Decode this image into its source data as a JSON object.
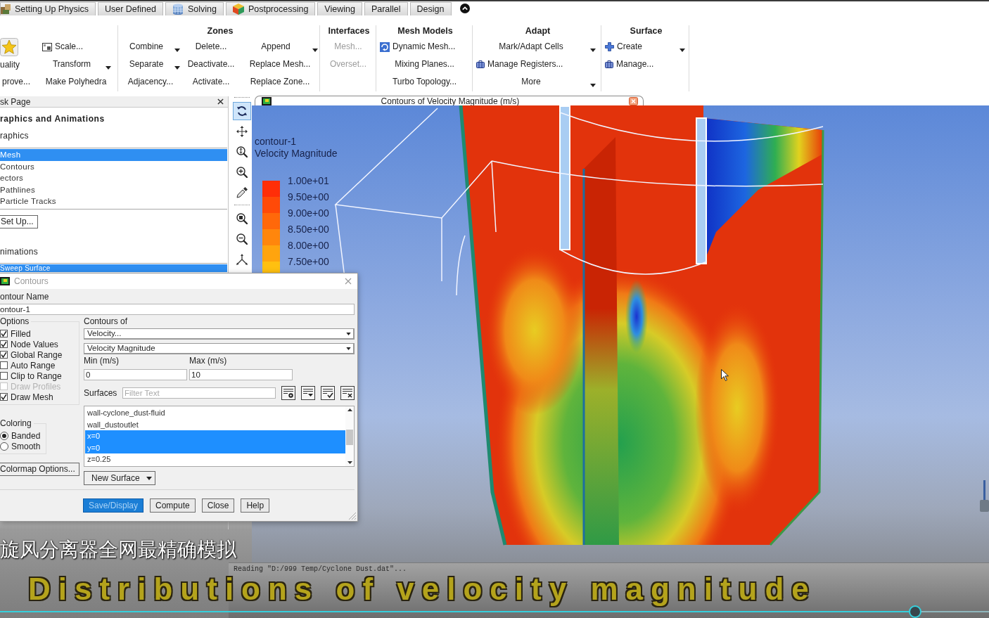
{
  "tabs": [
    {
      "label": "Setting Up Physics",
      "selected": false
    },
    {
      "label": "User Defined",
      "selected": false
    },
    {
      "label": "Solving",
      "selected": false
    },
    {
      "label": "Postprocessing",
      "selected": false
    },
    {
      "label": "Viewing",
      "selected": false
    },
    {
      "label": "Parallel",
      "selected": false
    },
    {
      "label": "Design",
      "selected": false
    }
  ],
  "ribbon": {
    "groups": [
      {
        "large_button": "uality",
        "columns": [
          [
            {
              "label": "prove..."
            }
          ],
          [
            {
              "label": "Scale...",
              "dropdown": false
            },
            {
              "label": "Transform",
              "dropdown": true
            },
            {
              "label": "Make Polyhedra",
              "dropdown": false
            }
          ]
        ]
      },
      {
        "title": "Zones",
        "columns": [
          [
            {
              "label": "Combine",
              "dropdown": true
            },
            {
              "label": "Separate",
              "dropdown": true
            },
            {
              "label": "Adjacency...",
              "dropdown": false
            }
          ],
          [
            {
              "label": "Delete..."
            },
            {
              "label": "Deactivate..."
            },
            {
              "label": "Activate..."
            }
          ],
          [
            {
              "label": "Append",
              "dropdown": true
            },
            {
              "label": "Replace Mesh...",
              "dropdown": false
            },
            {
              "label": "Replace Zone...",
              "dropdown": false
            }
          ]
        ]
      },
      {
        "title": "Interfaces",
        "columns": [
          [
            {
              "label": "Mesh...",
              "disabled": true
            },
            {
              "label": "Overset...",
              "disabled": true
            }
          ]
        ]
      },
      {
        "title": "Mesh Models",
        "columns": [
          [
            {
              "label": "Dynamic Mesh..."
            },
            {
              "label": "Mixing Planes..."
            },
            {
              "label": "Turbo Topology..."
            }
          ]
        ]
      },
      {
        "title": "Adapt",
        "columns": [
          [
            {
              "label": "Mark/Adapt Cells",
              "dropdown": true
            },
            {
              "label": "Manage Registers...",
              "dropdown": false
            },
            {
              "label": "More",
              "dropdown": true
            }
          ]
        ]
      },
      {
        "title": "Surface",
        "columns": [
          [
            {
              "label": "Create",
              "dropdown": true
            },
            {
              "label": "Manage...",
              "dropdown": false
            }
          ]
        ]
      }
    ]
  },
  "task_page": {
    "title": "sk Page",
    "heading": "raphics and Animations",
    "sections": [
      {
        "label": "raphics",
        "items": [
          {
            "label": "Mesh",
            "selected": true
          },
          {
            "label": "Contours",
            "selected": false
          },
          {
            "label": "ectors",
            "selected": false
          },
          {
            "label": "Pathlines",
            "selected": false
          },
          {
            "label": "Particle Tracks",
            "selected": false
          }
        ],
        "button": "Set Up..."
      },
      {
        "label": "nimations",
        "items": [
          {
            "label": "Sweep Surface",
            "selected": true
          }
        ]
      }
    ]
  },
  "graphics_toolbar": {
    "groups": [
      [
        {
          "selected": true
        },
        {
          "selected": false
        },
        {
          "selected": false
        },
        {
          "selected": false
        },
        {
          "selected": false
        }
      ],
      [
        {
          "selected": false
        },
        {
          "selected": false
        },
        {
          "selected": false
        }
      ]
    ]
  },
  "graphics_window": {
    "title": "Contours of Velocity Magnitude (m/s)",
    "legend": {
      "name": "contour-1",
      "quantity": "Velocity Magnitude",
      "levels": [
        {
          "label": "1.00e+01",
          "color": "#ff2e08"
        },
        {
          "label": "9.50e+00",
          "color": "#ff4a08"
        },
        {
          "label": "9.00e+00",
          "color": "#ff680a"
        },
        {
          "label": "8.50e+00",
          "color": "#ff860c"
        },
        {
          "label": "8.00e+00",
          "color": "#ffa40e"
        },
        {
          "label": "7.50e+00",
          "color": "#ffc010"
        }
      ]
    }
  },
  "console": {
    "lines": [
      "Reading \"D:/999 Temp/Cyclone Dust.dat\"..."
    ]
  },
  "contours_dialog": {
    "title": "Contours",
    "name_field": {
      "label": "ontour Name",
      "value": "ontour-1"
    },
    "options": {
      "label": "Options",
      "items": [
        {
          "label": "Filled",
          "checked": true,
          "disabled": false
        },
        {
          "label": "Node Values",
          "checked": true,
          "disabled": false
        },
        {
          "label": "Global Range",
          "checked": true,
          "disabled": false
        },
        {
          "label": "Auto Range",
          "checked": false,
          "disabled": false
        },
        {
          "label": "Clip to Range",
          "checked": false,
          "disabled": false
        },
        {
          "label": "Draw Profiles",
          "checked": false,
          "disabled": true
        },
        {
          "label": "Draw Mesh",
          "checked": true,
          "disabled": false
        }
      ]
    },
    "coloring": {
      "label": "Coloring",
      "options": [
        {
          "label": "Banded",
          "selected": true
        },
        {
          "label": "Smooth",
          "selected": false
        }
      ]
    },
    "colormap_button": "Colormap Options...",
    "contours_of": {
      "label": "Contours of",
      "category": "Velocity...",
      "quantity": "Velocity Magnitude"
    },
    "range": [
      {
        "label": "Min (m/s)",
        "value": "0"
      },
      {
        "label": "Max (m/s)",
        "value": "10"
      }
    ],
    "surfaces": {
      "label": "Surfaces",
      "placeholder": "Filter Text",
      "items": [
        {
          "label": "wall-cyclone_dust-fluid",
          "selected": false
        },
        {
          "label": "wall_dustoutlet",
          "selected": false
        },
        {
          "label": "x=0",
          "selected": true
        },
        {
          "label": "y=0",
          "selected": true
        },
        {
          "label": "z=0.25",
          "selected": false
        }
      ]
    },
    "new_surface_button": "New Surface",
    "buttons": [
      {
        "label": "Save/Display",
        "kind": "primary"
      },
      {
        "label": "Compute",
        "kind": "normal"
      },
      {
        "label": "Close",
        "kind": "normal"
      },
      {
        "label": "Help",
        "kind": "normal"
      }
    ]
  },
  "video": {
    "caption_cn": "旋风分离器全网最精确模拟",
    "caption_en": "Distributions of velocity magnitude",
    "progress": {
      "level": 0.925
    }
  }
}
